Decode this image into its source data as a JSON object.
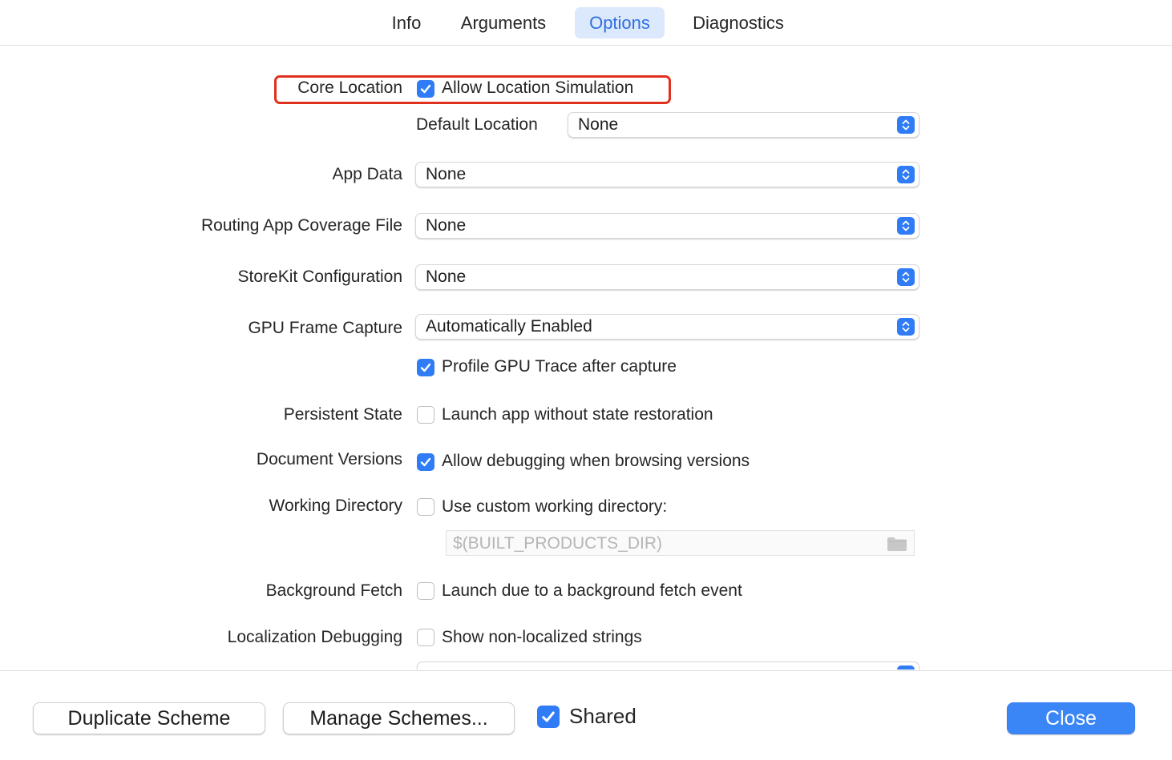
{
  "tabs": [
    {
      "label": "Info"
    },
    {
      "label": "Arguments"
    },
    {
      "label": "Options"
    },
    {
      "label": "Diagnostics"
    }
  ],
  "active_tab": "Options",
  "rows": {
    "core_location": {
      "label": "Core Location",
      "checkbox_label": "Allow Location Simulation",
      "checked": true
    },
    "default_location": {
      "label": "Default Location",
      "value": "None"
    },
    "app_data": {
      "label": "App Data",
      "value": "None"
    },
    "routing": {
      "label": "Routing App Coverage File",
      "value": "None"
    },
    "storekit": {
      "label": "StoreKit Configuration",
      "value": "None"
    },
    "gpu_frame": {
      "label": "GPU Frame Capture",
      "value": "Automatically Enabled",
      "checkbox_label": "Profile GPU Trace after capture",
      "checked": true
    },
    "persistent_state": {
      "label": "Persistent State",
      "checkbox_label": "Launch app without state restoration",
      "checked": false
    },
    "document_versions": {
      "label": "Document Versions",
      "checkbox_label": "Allow debugging when browsing versions",
      "checked": true
    },
    "working_directory": {
      "label": "Working Directory",
      "checkbox_label": "Use custom working directory:",
      "checked": false,
      "path_placeholder": "$(BUILT_PRODUCTS_DIR)"
    },
    "background_fetch": {
      "label": "Background Fetch",
      "checkbox_label": "Launch due to a background fetch event",
      "checked": false
    },
    "localization": {
      "label": "Localization Debugging",
      "checkbox_label": "Show non-localized strings",
      "checked": false
    }
  },
  "footer": {
    "duplicate_label": "Duplicate Scheme",
    "manage_label": "Manage Schemes...",
    "shared_label": "Shared",
    "shared_checked": true,
    "close_label": "Close"
  },
  "colors": {
    "accent": "#2f7cf6",
    "highlight": "#e0301e",
    "tab_active_bg": "#dce8fb"
  },
  "icons": [
    "checkmark-icon",
    "popup-arrows-icon",
    "folder-icon"
  ]
}
